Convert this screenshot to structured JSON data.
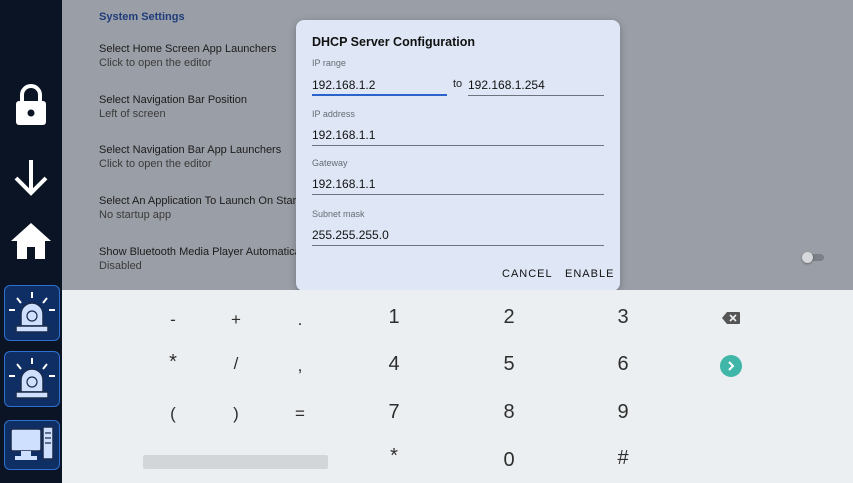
{
  "sidebar": {
    "icons": [
      "lock-icon",
      "arrow-down-icon",
      "home-icon",
      "alarm-light-icon",
      "alarm-light-icon",
      "computer-icon"
    ]
  },
  "settings": {
    "section_title": "System Settings",
    "items": [
      {
        "title": "Select Home Screen App Launchers",
        "subtitle": "Click to open the editor"
      },
      {
        "title": "Select Navigation Bar Position",
        "subtitle": "Left of screen"
      },
      {
        "title": "Select Navigation Bar App Launchers",
        "subtitle": "Click to open the editor"
      },
      {
        "title": "Select An Application To Launch On Startup",
        "subtitle": "No startup app"
      },
      {
        "title": "Show Bluetooth Media Player Automatically",
        "subtitle": "Disabled"
      }
    ]
  },
  "dialog": {
    "title": "DHCP Server Configuration",
    "ip_range_label": "IP range",
    "ip_range_start": "192.168.1.2",
    "to_label": "to",
    "ip_range_end": "192.168.1.254",
    "ip_address_label": "IP address",
    "ip_address": "192.168.1.1",
    "gateway_label": "Gateway",
    "gateway": "192.168.1.1",
    "subnet_label": "Subnet mask",
    "subnet": "255.255.255.0",
    "cancel": "CANCEL",
    "enable": "ENABLE"
  },
  "keyboard": {
    "row1": [
      "-",
      "+",
      ".",
      "1",
      "2",
      "3"
    ],
    "row2": [
      "*",
      "/",
      ",",
      "4",
      "5",
      "6"
    ],
    "row3": [
      "(",
      ")",
      "=",
      "7",
      "8",
      "9"
    ],
    "row4": [
      "*",
      "0",
      "#"
    ]
  },
  "colors": {
    "sidebar": "#0b1424",
    "dialog": "#dfe7f6",
    "accent": "#2a63c9",
    "go_key": "#3fb6a8"
  }
}
